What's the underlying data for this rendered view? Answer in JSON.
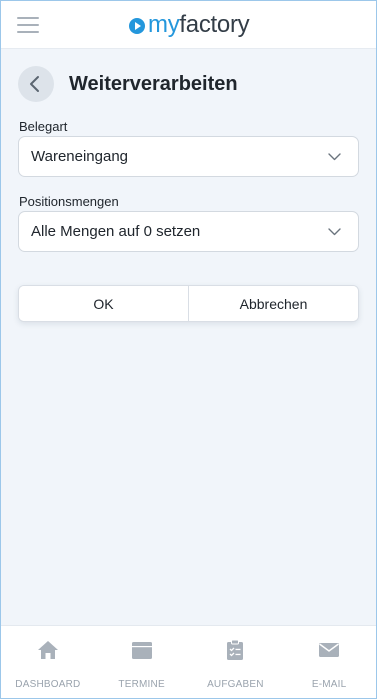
{
  "header": {
    "menu_icon": "hamburger-menu-icon",
    "logo_prefix": "my",
    "logo_name": "factory",
    "brand_color": "#2497dc"
  },
  "page": {
    "back_icon": "chevron-left-icon",
    "title": "Weiterverarbeiten"
  },
  "form": {
    "belegart": {
      "label": "Belegart",
      "value": "Wareneingang"
    },
    "positionsmengen": {
      "label": "Positionsmengen",
      "value": "Alle Mengen auf 0 setzen"
    }
  },
  "actions": {
    "ok_label": "OK",
    "cancel_label": "Abbrechen"
  },
  "bottom_nav": {
    "items": [
      {
        "label": "DASHBOARD",
        "icon": "home-icon"
      },
      {
        "label": "TERMINE",
        "icon": "calendar-icon"
      },
      {
        "label": "AUFGABEN",
        "icon": "clipboard-icon"
      },
      {
        "label": "E-MAIL",
        "icon": "mail-icon"
      }
    ]
  }
}
